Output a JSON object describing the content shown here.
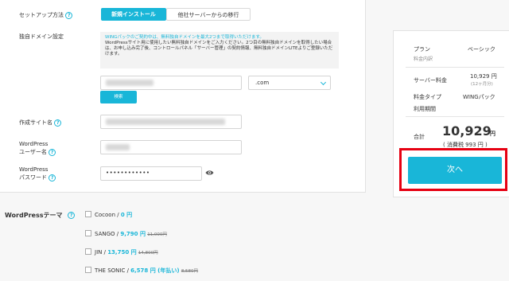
{
  "form": {
    "setup_label": "セットアップ方法",
    "tabs": [
      {
        "label": "新規インストール",
        "active": true
      },
      {
        "label": "他社サーバーからの移行",
        "active": false
      }
    ],
    "domain_label": "独自ドメイン設定",
    "domain_note_1": "WINGパックのご契約中は、無料独自ドメインを最大2つまで取得いただけます。",
    "domain_note_2": "WordPressサイト用に使用したい無料独自ドメインをご入力ください。2つ目の無料独自ドメインを取得したい場合は、お申し込み完了後、コントロールパネル「サーバー管理」の契約情報、無料独自ドメインLITEよりご登録いただけます。",
    "tld_value": ".com",
    "search_button": "検索",
    "site_name_label": "作成サイト名",
    "wp_user_label_1": "WordPress",
    "wp_user_label_2": "ユーザー名",
    "wp_pass_label_1": "WordPress",
    "wp_pass_label_2": "パスワード",
    "password_mask": "••••••••••••"
  },
  "summary": {
    "plan_label": "プラン",
    "plan_value": "ベーシック",
    "breakdown_label": "料金内訳",
    "server_fee_label": "サーバー料金",
    "server_fee_value": "10,929 円",
    "server_fee_sub": "(12ヶ月分)",
    "fee_type_label": "料金タイプ",
    "fee_type_value": "WINGパック",
    "period_label": "利用期間",
    "total_label": "合計",
    "total_value": "10,929",
    "total_unit": "円",
    "tax_note": "( 消費税 993 円 )",
    "next_button": "次へ"
  },
  "themes": {
    "label": "WordPressテーマ",
    "options": [
      {
        "name": "Cocoon",
        "sep": " / ",
        "price": "0 円",
        "old": ""
      },
      {
        "name": "SANGO",
        "sep": " / ",
        "price": "9,790 円",
        "old": "11,000円"
      },
      {
        "name": "JIN",
        "sep": " / ",
        "price": "13,750 円",
        "old": "14,800円"
      },
      {
        "name": "THE SONIC",
        "sep": " / ",
        "price": "6,578 円 (年払い)",
        "old": "8,580円"
      }
    ]
  },
  "colors": {
    "accent": "#19b6d8",
    "highlight": "#e60012"
  }
}
